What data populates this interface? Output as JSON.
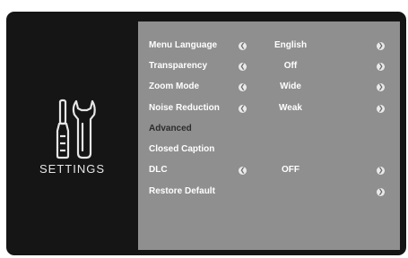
{
  "sidebar": {
    "title": "SETTINGS",
    "icon": "wrench-screwdriver-icon"
  },
  "menu": {
    "rows": [
      {
        "label": "Menu Language",
        "value": "English"
      },
      {
        "label": "Transparency",
        "value": "Off"
      },
      {
        "label": "Zoom Mode",
        "value": "Wide"
      },
      {
        "label": "Noise Reduction",
        "value": "Weak"
      },
      {
        "label": "Advanced"
      },
      {
        "label": "Closed Caption"
      },
      {
        "label": "DLC",
        "value": "OFF"
      },
      {
        "label": "Restore Default"
      }
    ]
  },
  "colors": {
    "panel": "#8f8f8f",
    "background": "#151515",
    "text": "#ffffff",
    "disabled_text": "#2c2c2c"
  }
}
